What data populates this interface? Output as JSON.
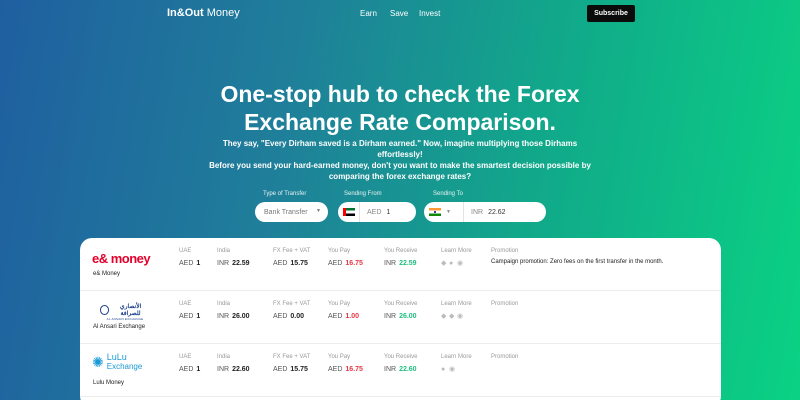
{
  "nav": {
    "brand_bold": "In&Out",
    "brand_rest": " Money",
    "links": [
      "Earn",
      "Save",
      "Invest"
    ],
    "subscribe": "Subscribe"
  },
  "hero": {
    "title_line1": "One-stop hub to check the Forex",
    "title_line2": "Exchange Rate Comparison.",
    "sub_line1": "They say, \"Every Dirham saved is a Dirham earned.\" Now, imagine multiplying those Dirhams effortlessly!",
    "sub_line2": "Before you send your hard-earned money, don't you want to make the smartest decision possible by",
    "sub_line3": "comparing the forex exchange rates?"
  },
  "form": {
    "type_label": "Type of Transfer",
    "type_value": "Bank Transfer",
    "from_label": "Sending From",
    "from_currency": "AED",
    "from_amount": "1",
    "to_label": "Sending To",
    "to_currency": "INR",
    "to_amount": "22.62"
  },
  "table": {
    "headers": {
      "uae": "UAE",
      "india": "India",
      "fx": "FX Fee + VAT",
      "pay": "You Pay",
      "receive": "You Receive",
      "learn": "Learn More",
      "promo": "Promotion"
    },
    "rows": [
      {
        "name": "e& Money",
        "logo_text": "e& money",
        "uae_cur": "AED",
        "uae_val": "1",
        "india_cur": "INR",
        "india_val": "22.59",
        "fx_cur": "AED",
        "fx_val": "15.75",
        "pay_cur": "AED",
        "pay_val": "16.75",
        "recv_cur": "INR",
        "recv_val": "22.59",
        "promo": "Campaign promotion: Zero fees on the first transfer in the month."
      },
      {
        "name": "Al Ansari Exchange",
        "logo_text": "AL ANSARI EXCHANGE",
        "uae_cur": "AED",
        "uae_val": "1",
        "india_cur": "INR",
        "india_val": "26.00",
        "fx_cur": "AED",
        "fx_val": "0.00",
        "pay_cur": "AED",
        "pay_val": "1.00",
        "recv_cur": "INR",
        "recv_val": "26.00",
        "promo": ""
      },
      {
        "name": "Lulu Money",
        "logo_text_1": "LuLu",
        "logo_text_2": "Exchange",
        "uae_cur": "AED",
        "uae_val": "1",
        "india_cur": "INR",
        "india_val": "22.60",
        "fx_cur": "AED",
        "fx_val": "15.75",
        "pay_cur": "AED",
        "pay_val": "16.75",
        "recv_cur": "INR",
        "recv_val": "22.60",
        "promo": ""
      }
    ]
  },
  "colors": {
    "pay": "#e63946",
    "receive": "#1fbf7f",
    "eand_red": "#e4002b",
    "lulu_blue": "#1a9ad6",
    "ansari_blue": "#1b3f8b"
  }
}
